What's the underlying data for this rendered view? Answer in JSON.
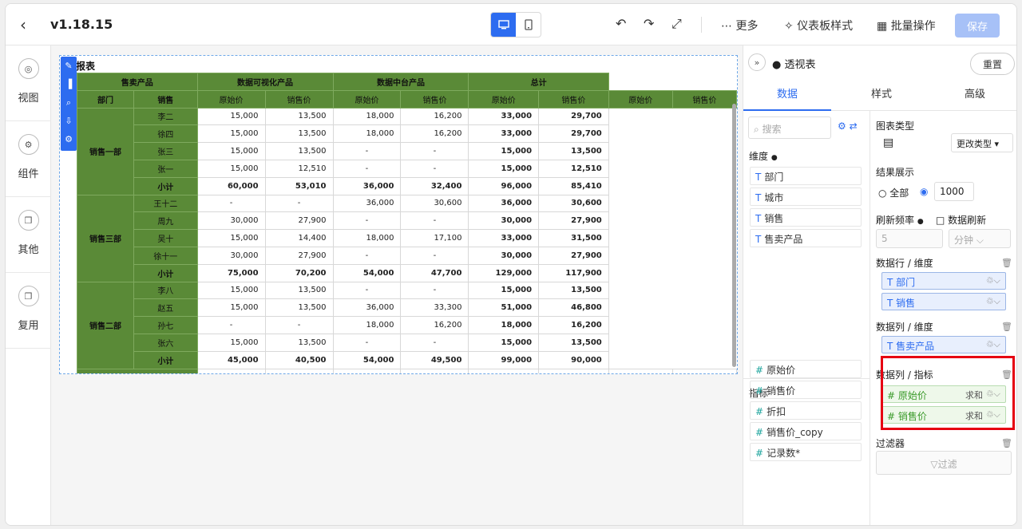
{
  "topbar": {
    "version": "v1.18.15",
    "more": "更多",
    "dashboard_style": "仪表板样式",
    "batch_ops": "批量操作",
    "save": "保存"
  },
  "leftbar": [
    {
      "label": "视图",
      "icon": "target-icon"
    },
    {
      "label": "组件",
      "icon": "gear-icon"
    },
    {
      "label": "其他",
      "icon": "box-icon"
    },
    {
      "label": "复用",
      "icon": "copy-icon"
    }
  ],
  "widget": {
    "title": "报表"
  },
  "pivot": {
    "col_groups": [
      "售卖产品",
      "数据可视化产品",
      "数据中台产品",
      "总计"
    ],
    "row_headers": [
      "部门",
      "销售"
    ],
    "measures": [
      "原始价",
      "销售价",
      "原始价",
      "销售价",
      "原始价",
      "销售价",
      "原始价",
      "销售价"
    ],
    "groups": [
      {
        "dept": "销售一部",
        "rows": [
          {
            "name": "李二",
            "vals": [
              "15,000",
              "13,500",
              "18,000",
              "16,200",
              "33,000",
              "29,700"
            ]
          },
          {
            "name": "徐四",
            "vals": [
              "15,000",
              "13,500",
              "18,000",
              "16,200",
              "33,000",
              "29,700"
            ]
          },
          {
            "name": "张三",
            "vals": [
              "15,000",
              "13,500",
              "-",
              "-",
              "15,000",
              "13,500"
            ]
          },
          {
            "name": "张一",
            "vals": [
              "15,000",
              "12,510",
              "-",
              "-",
              "15,000",
              "12,510"
            ]
          },
          {
            "name": "小计",
            "vals": [
              "60,000",
              "53,010",
              "36,000",
              "32,400",
              "96,000",
              "85,410"
            ],
            "subtotal": true
          }
        ]
      },
      {
        "dept": "销售三部",
        "rows": [
          {
            "name": "王十二",
            "vals": [
              "-",
              "-",
              "36,000",
              "30,600",
              "36,000",
              "30,600"
            ]
          },
          {
            "name": "周九",
            "vals": [
              "30,000",
              "27,900",
              "-",
              "-",
              "30,000",
              "27,900"
            ]
          },
          {
            "name": "吴十",
            "vals": [
              "15,000",
              "14,400",
              "18,000",
              "17,100",
              "33,000",
              "31,500"
            ]
          },
          {
            "name": "徐十一",
            "vals": [
              "30,000",
              "27,900",
              "-",
              "-",
              "30,000",
              "27,900"
            ]
          },
          {
            "name": "小计",
            "vals": [
              "75,000",
              "70,200",
              "54,000",
              "47,700",
              "129,000",
              "117,900"
            ],
            "subtotal": true
          }
        ]
      },
      {
        "dept": "销售二部",
        "rows": [
          {
            "name": "李八",
            "vals": [
              "15,000",
              "13,500",
              "-",
              "-",
              "15,000",
              "13,500"
            ]
          },
          {
            "name": "赵五",
            "vals": [
              "15,000",
              "13,500",
              "36,000",
              "33,300",
              "51,000",
              "46,800"
            ]
          },
          {
            "name": "孙七",
            "vals": [
              "-",
              "-",
              "18,000",
              "16,200",
              "18,000",
              "16,200"
            ]
          },
          {
            "name": "张六",
            "vals": [
              "15,000",
              "13,500",
              "-",
              "-",
              "15,000",
              "13,500"
            ]
          },
          {
            "name": "小计",
            "vals": [
              "45,000",
              "40,500",
              "54,000",
              "49,500",
              "99,000",
              "90,000"
            ],
            "subtotal": true
          }
        ]
      }
    ],
    "grand_total_label": "总计"
  },
  "rpanel": {
    "title": "透视表",
    "reset": "重置",
    "tabs": [
      "数据",
      "样式",
      "高级"
    ],
    "search_placeholder": "搜索",
    "dimension_label": "维度",
    "dimensions": [
      "部门",
      "城市",
      "销售",
      "售卖产品"
    ],
    "measure_label": "指标",
    "measures": [
      "原始价",
      "销售价",
      "折扣",
      "销售价_copy",
      "记录数*"
    ],
    "chart_type_label": "图表类型",
    "change_type": "更改类型",
    "result_label": "结果展示",
    "result_all": "全部",
    "result_count": "1000",
    "refresh_label": "刷新频率",
    "data_refresh": "数据刷新",
    "refresh_value": "5",
    "refresh_unit": "分钟",
    "row_dim_label": "数据行 / 维度",
    "row_dims": [
      "部门",
      "销售"
    ],
    "col_dim_label": "数据列 / 维度",
    "col_dims": [
      "售卖产品"
    ],
    "col_measure_label": "数据列 / 指标",
    "col_measures": [
      {
        "name": "原始价",
        "agg": "求和"
      },
      {
        "name": "销售价",
        "agg": "求和"
      }
    ],
    "filter_label": "过滤器",
    "filter_btn": "过滤"
  }
}
